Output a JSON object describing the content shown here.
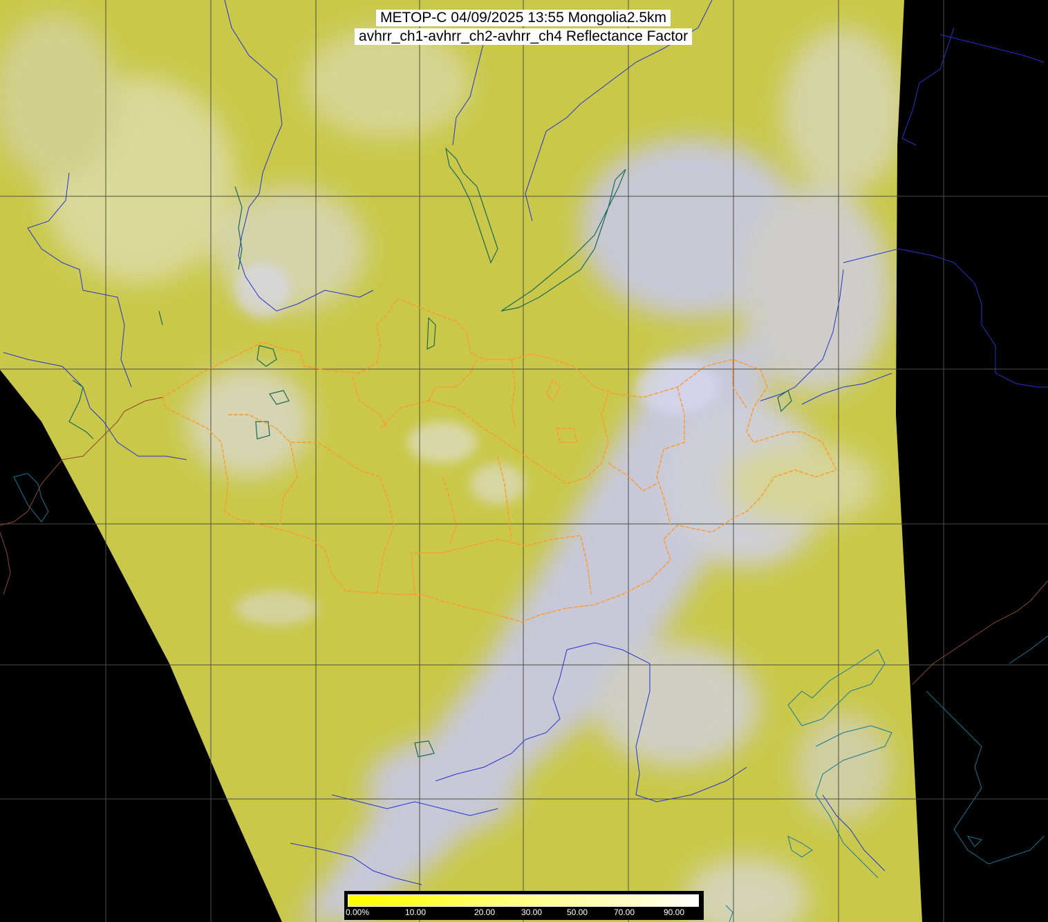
{
  "title": {
    "line1": "METOP-C 04/09/2025 13:55 Mongolia2.5km",
    "line2": "avhrr_ch1-avhrr_ch2-avhrr_ch4 Reflectance Factor"
  },
  "colorbar": {
    "labels": [
      "0.00%",
      "10.00",
      "20.00",
      "30.00",
      "50.00",
      "70.00",
      "90.00"
    ],
    "gradient": [
      "#ffff00",
      "#ffff22",
      "#ffff55",
      "#ffff88",
      "#ffffaa",
      "#ffffcc",
      "#ffffff"
    ]
  },
  "colors": {
    "background": "#000000",
    "swath_yellow": "#cccc44",
    "cloud_lavender": "#c8c8f0",
    "graticule": "#4a4a40",
    "river_blue": "#2233cc",
    "lake_teal": "#226655",
    "border_orange": "#ff9922",
    "coast_cyan": "#117799"
  }
}
